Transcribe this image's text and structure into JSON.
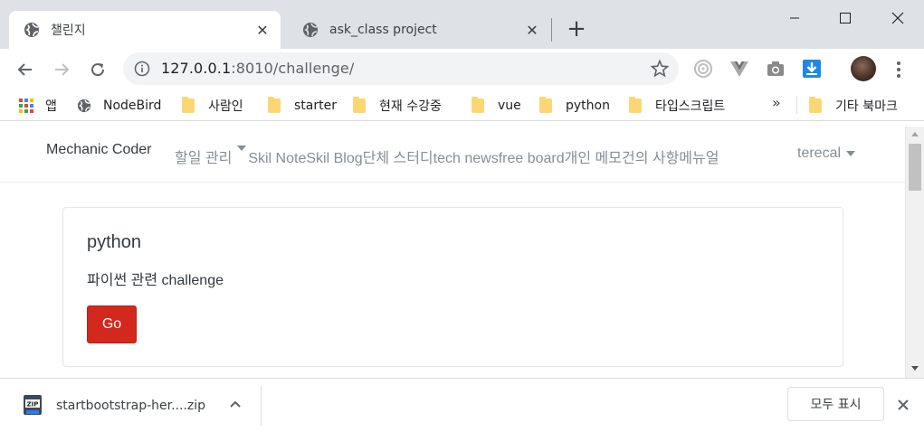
{
  "browser": {
    "tabs": [
      {
        "title": "챌린지",
        "active": true
      },
      {
        "title": "ask_class project",
        "active": false
      }
    ],
    "url_host": "127.0.0.1",
    "url_path": ":8010/challenge/",
    "bookmarks": [
      {
        "label": "앱",
        "icon": "apps-grid-icon"
      },
      {
        "label": "NodeBird",
        "icon": "globe-icon"
      },
      {
        "label": "사람인",
        "icon": "folder-icon"
      },
      {
        "label": "starter",
        "icon": "folder-icon"
      },
      {
        "label": "현재 수강중",
        "icon": "folder-icon"
      },
      {
        "label": "vue",
        "icon": "folder-icon"
      },
      {
        "label": "python",
        "icon": "folder-icon"
      },
      {
        "label": "타입스크립트",
        "icon": "folder-icon"
      }
    ],
    "bookmarks_overflow": "»",
    "other_bookmarks": "기타 북마크"
  },
  "site": {
    "brand": "Mechanic Coder",
    "nav": {
      "dropdown": "할일 관리",
      "links": [
        "Skil Note",
        "Skil Blog",
        "단체 스터디",
        "tech news",
        "free board",
        "개인 메모",
        "건의 사항",
        "메뉴얼"
      ]
    },
    "user": "terecal"
  },
  "card": {
    "title": "python",
    "text": "파이썬 관련 challenge",
    "button": "Go"
  },
  "download_shelf": {
    "file_name": "startbootstrap-her....zip",
    "show_all": "모두 표시"
  },
  "colors": {
    "go_button": "#d2281d",
    "tabstrip": "#dee1e6",
    "folder": "#fbd774"
  }
}
